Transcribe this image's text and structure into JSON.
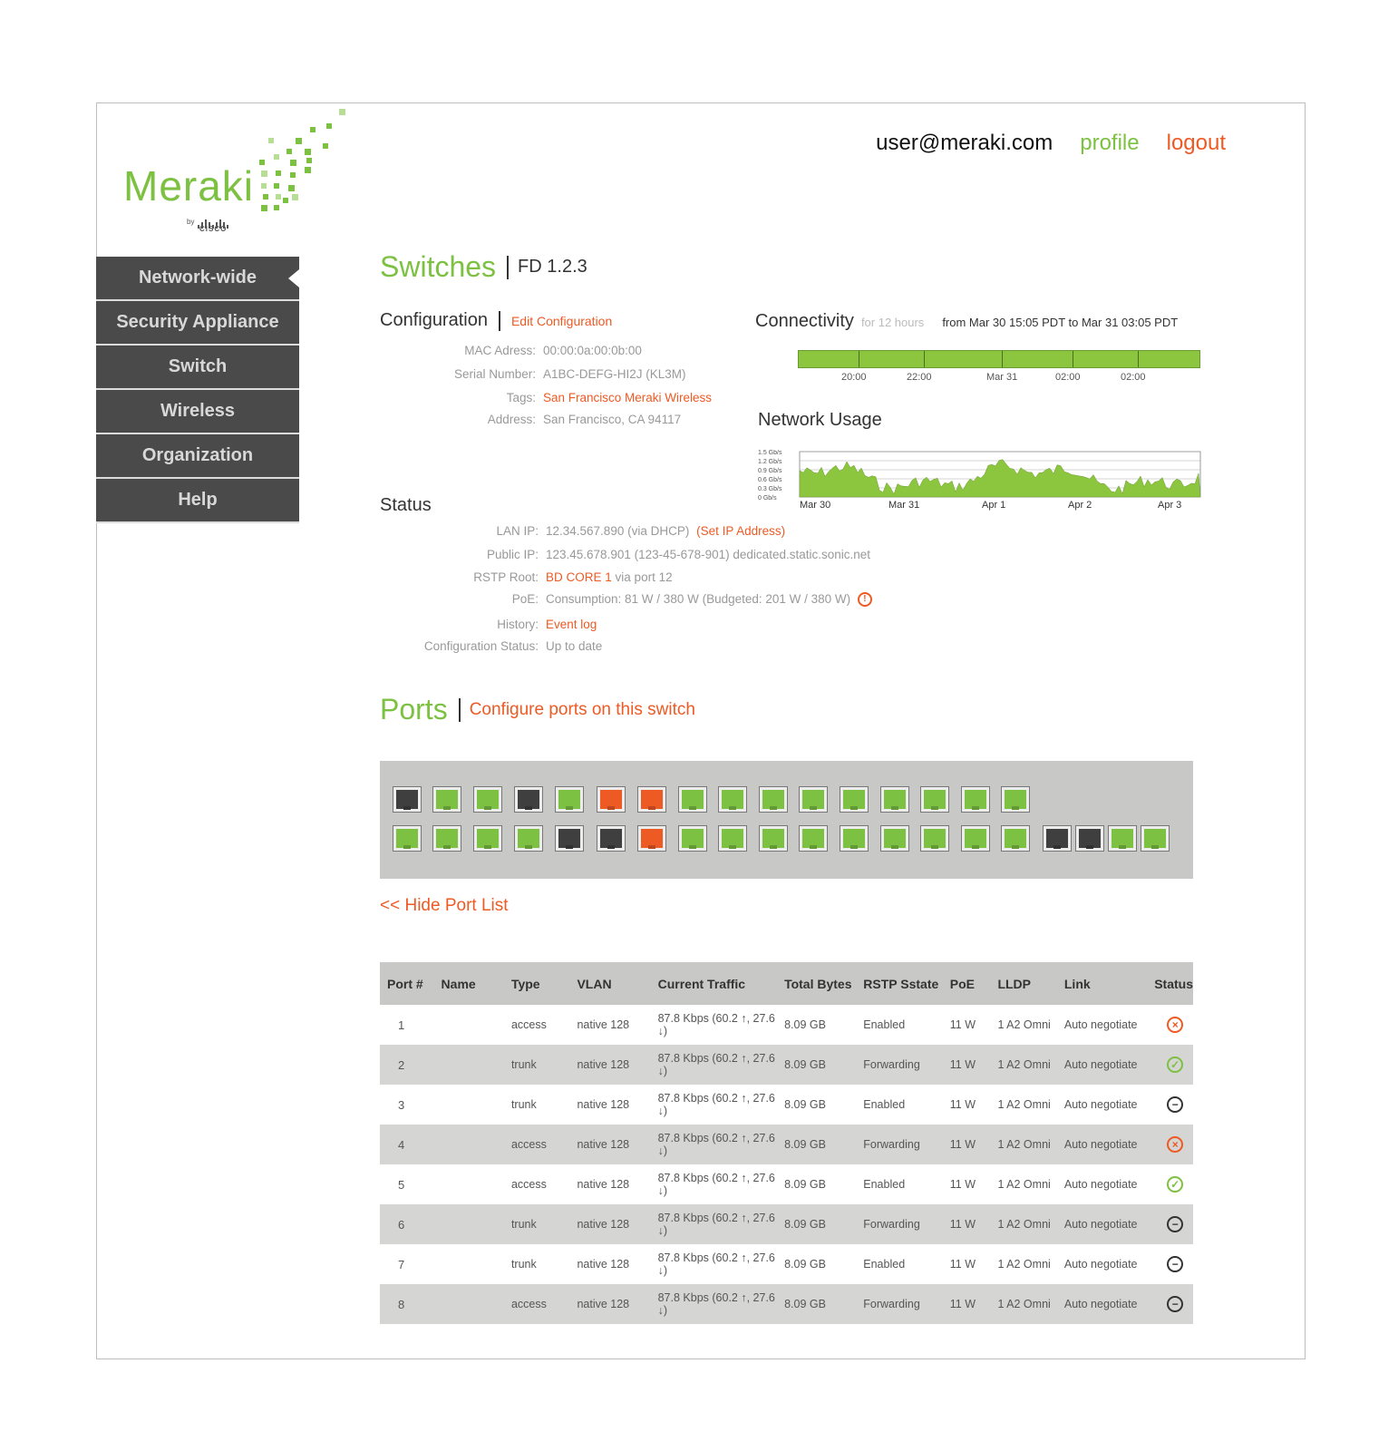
{
  "brand": {
    "name": "Meraki",
    "by": "by",
    "parent": "CISCO"
  },
  "user": {
    "email": "user@meraki.com",
    "profile": "profile",
    "logout": "logout"
  },
  "nav": [
    "Network-wide",
    "Security Appliance",
    "Switch",
    "Wireless",
    "Organization",
    "Help"
  ],
  "page": {
    "title": "Switches",
    "subtitle": "FD 1.2.3"
  },
  "configuration": {
    "heading": "Configuration",
    "edit_link": "Edit Configuration",
    "fields": [
      {
        "label": "MAC Adress:",
        "value": "00:00:0a:00:0b:00"
      },
      {
        "label": "Serial Number:",
        "value": "A1BC-DEFG-HI2J (KL3M)"
      },
      {
        "label": "Tags:",
        "value": "San Francisco Meraki Wireless"
      },
      {
        "label": "Address:",
        "value": "San Francisco, CA 94117"
      }
    ]
  },
  "connectivity": {
    "heading": "Connectivity",
    "span": "for 12 hours",
    "range": "from Mar 30 15:05 PDT to Mar 31 03:05 PDT",
    "ticks": [
      "20:00",
      "22:00",
      "Mar 31",
      "02:00",
      "02:00"
    ]
  },
  "network_usage": {
    "heading": "Network Usage",
    "y_labels": [
      "1.5 Gb/s",
      "1.2 Gb/s",
      "0.9 Gb/s",
      "0.6 Gb/s",
      "0.3 Gb/s",
      "0 Gb/s"
    ],
    "x_labels": [
      "Mar 30",
      "Mar 31",
      "Apr 1",
      "Apr 2",
      "Apr 3"
    ]
  },
  "status": {
    "heading": "Status",
    "lan_ip": {
      "label": "LAN IP:",
      "value": "12.34.567.890 (via DHCP)",
      "link": "(Set IP Address)"
    },
    "public_ip": {
      "label": "Public IP:",
      "value": "123.45.678.901 (123-45-678-901) dedicated.static.sonic.net"
    },
    "rstp_root": {
      "label": "RSTP Root:",
      "link": "BD CORE 1",
      "value": "via port 12"
    },
    "poe": {
      "label": "PoE:",
      "value": "Consumption: 81 W / 380 W (Budgeted:  201 W / 380 W)",
      "icon": "warning-icon"
    },
    "history": {
      "label": "History:",
      "link": "Event log"
    },
    "config_status": {
      "label": "Configuration Status:",
      "value": "Up to date"
    }
  },
  "ports": {
    "heading": "Ports",
    "configure_link": "Configure ports on this switch",
    "hide_link": "<< Hide Port List",
    "colors": {
      "active": "#7dc142",
      "inactive": "#3f3f3f",
      "error": "#ee5a24"
    },
    "top_row": [
      "inactive",
      "active",
      "active",
      "inactive",
      "active",
      "error",
      "error",
      "active",
      "active",
      "active",
      "active",
      "active",
      "active",
      "active",
      "active",
      "active"
    ],
    "bottom_row": [
      "active",
      "active",
      "active",
      "active",
      "inactive",
      "inactive",
      "error",
      "active",
      "active",
      "active",
      "active",
      "active",
      "active",
      "active",
      "active",
      "active"
    ],
    "uplinks": [
      "inactive",
      "inactive",
      "active",
      "active"
    ]
  },
  "port_table": {
    "headers": [
      "Port #",
      "Name",
      "Type",
      "VLAN",
      "Current Traffic",
      "Total Bytes",
      "RSTP Sstate",
      "PoE",
      "LLDP",
      "Link",
      "Status"
    ],
    "rows": [
      {
        "port": "1",
        "name": "",
        "type": "access",
        "vlan": "native 128",
        "traffic": "87.8 Kbps (60.2 ↑, 27.6 ↓)",
        "bytes": "8.09 GB",
        "rstp": "Enabled",
        "poe": "11 W",
        "lldp": "1 A2 Omni",
        "link": "Auto negotiate",
        "status": "error"
      },
      {
        "port": "2",
        "name": "",
        "type": "trunk",
        "vlan": "native 128",
        "traffic": "87.8 Kbps (60.2 ↑, 27.6 ↓)",
        "bytes": "8.09 GB",
        "rstp": "Forwarding",
        "poe": "11 W",
        "lldp": "1 A2 Omni",
        "link": "Auto negotiate",
        "status": "ok"
      },
      {
        "port": "3",
        "name": "",
        "type": "trunk",
        "vlan": "native 128",
        "traffic": "87.8 Kbps (60.2 ↑, 27.6 ↓)",
        "bytes": "8.09 GB",
        "rstp": "Enabled",
        "poe": "11 W",
        "lldp": "1 A2 Omni",
        "link": "Auto negotiate",
        "status": "off"
      },
      {
        "port": "4",
        "name": "",
        "type": "access",
        "vlan": "native 128",
        "traffic": "87.8 Kbps (60.2 ↑, 27.6 ↓)",
        "bytes": "8.09 GB",
        "rstp": "Forwarding",
        "poe": "11 W",
        "lldp": "1 A2 Omni",
        "link": "Auto negotiate",
        "status": "error"
      },
      {
        "port": "5",
        "name": "",
        "type": "access",
        "vlan": "native 128",
        "traffic": "87.8 Kbps (60.2 ↑, 27.6 ↓)",
        "bytes": "8.09 GB",
        "rstp": "Enabled",
        "poe": "11 W",
        "lldp": "1 A2 Omni",
        "link": "Auto negotiate",
        "status": "ok"
      },
      {
        "port": "6",
        "name": "",
        "type": "trunk",
        "vlan": "native 128",
        "traffic": "87.8 Kbps (60.2 ↑, 27.6 ↓)",
        "bytes": "8.09 GB",
        "rstp": "Forwarding",
        "poe": "11 W",
        "lldp": "1 A2 Omni",
        "link": "Auto negotiate",
        "status": "off"
      },
      {
        "port": "7",
        "name": "",
        "type": "trunk",
        "vlan": "native 128",
        "traffic": "87.8 Kbps (60.2 ↑, 27.6 ↓)",
        "bytes": "8.09 GB",
        "rstp": "Enabled",
        "poe": "11 W",
        "lldp": "1 A2 Omni",
        "link": "Auto negotiate",
        "status": "off"
      },
      {
        "port": "8",
        "name": "",
        "type": "access",
        "vlan": "native 128",
        "traffic": "87.8 Kbps (60.2 ↑, 27.6 ↓)",
        "bytes": "8.09 GB",
        "rstp": "Forwarding",
        "poe": "11 W",
        "lldp": "1 A2 Omni",
        "link": "Auto negotiate",
        "status": "off"
      }
    ]
  }
}
